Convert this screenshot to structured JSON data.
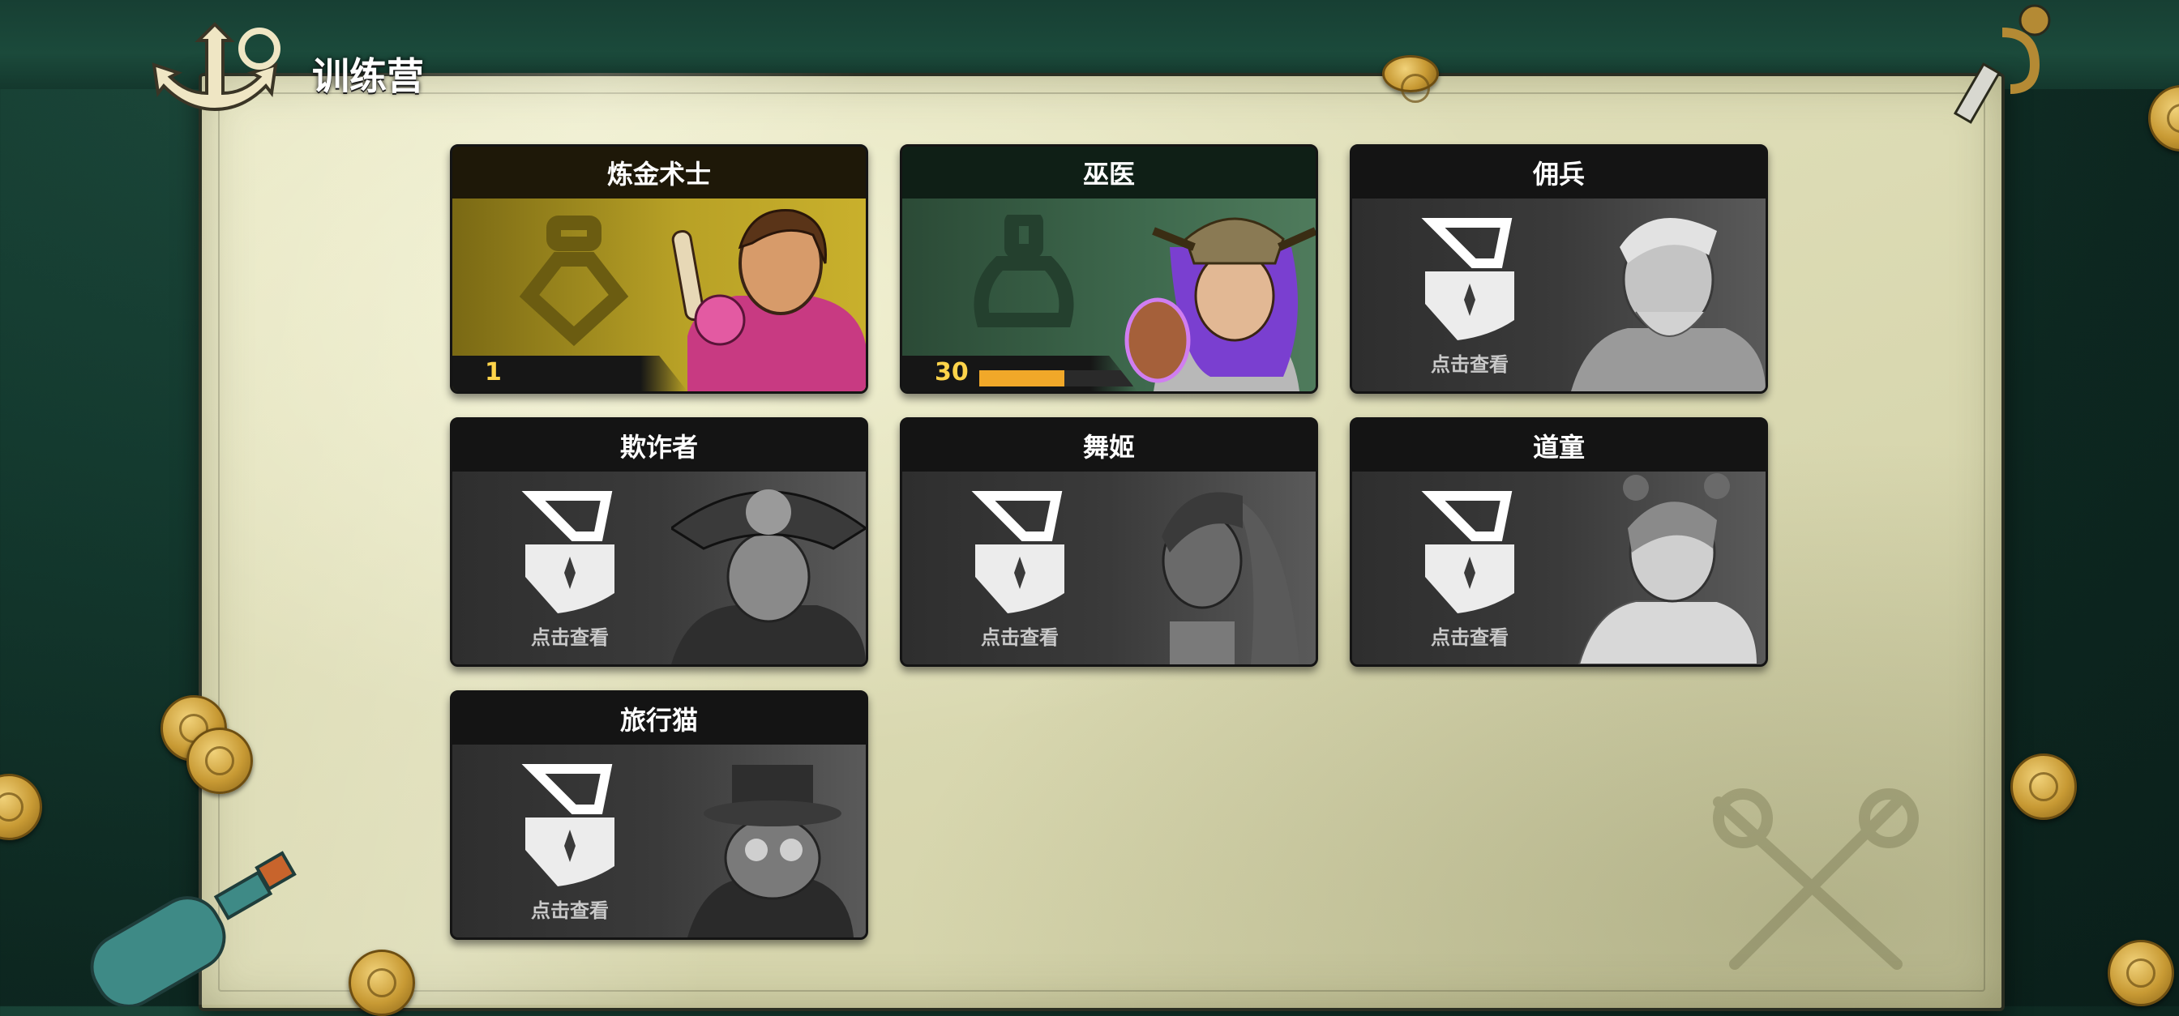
{
  "header": {
    "title": "训练营"
  },
  "cards": [
    {
      "name": "炼金术士",
      "state": "unlocked",
      "level": "1",
      "xp_progress": 0.0,
      "theme": "gold",
      "portrait": "alchemist-portrait"
    },
    {
      "name": "巫医",
      "state": "unlocked",
      "level": "30",
      "xp_progress": 0.55,
      "theme": "green",
      "portrait": "witch-doctor-portrait"
    },
    {
      "name": "佣兵",
      "state": "locked",
      "action_label": "点击查看",
      "portrait": "mercenary-portrait"
    },
    {
      "name": "欺诈者",
      "state": "locked",
      "action_label": "点击查看",
      "portrait": "trickster-portrait"
    },
    {
      "name": "舞姬",
      "state": "locked",
      "action_label": "点击查看",
      "portrait": "dancer-portrait"
    },
    {
      "name": "道童",
      "state": "locked",
      "action_label": "点击查看",
      "portrait": "taoist-portrait"
    },
    {
      "name": "旅行猫",
      "state": "locked",
      "action_label": "点击查看",
      "portrait": "travel-cat-portrait"
    }
  ],
  "colors": {
    "gold_card": "#c9b02c",
    "green_card": "#4f7b5c",
    "level_text": "#ffd44a",
    "xp_fill": "#f1a829",
    "parchment": "#e2e1bc"
  },
  "icons": [
    "anchor-icon",
    "sword-icon",
    "coin-icon",
    "bottle-icon",
    "flask-emblem-icon",
    "lock-icon"
  ]
}
